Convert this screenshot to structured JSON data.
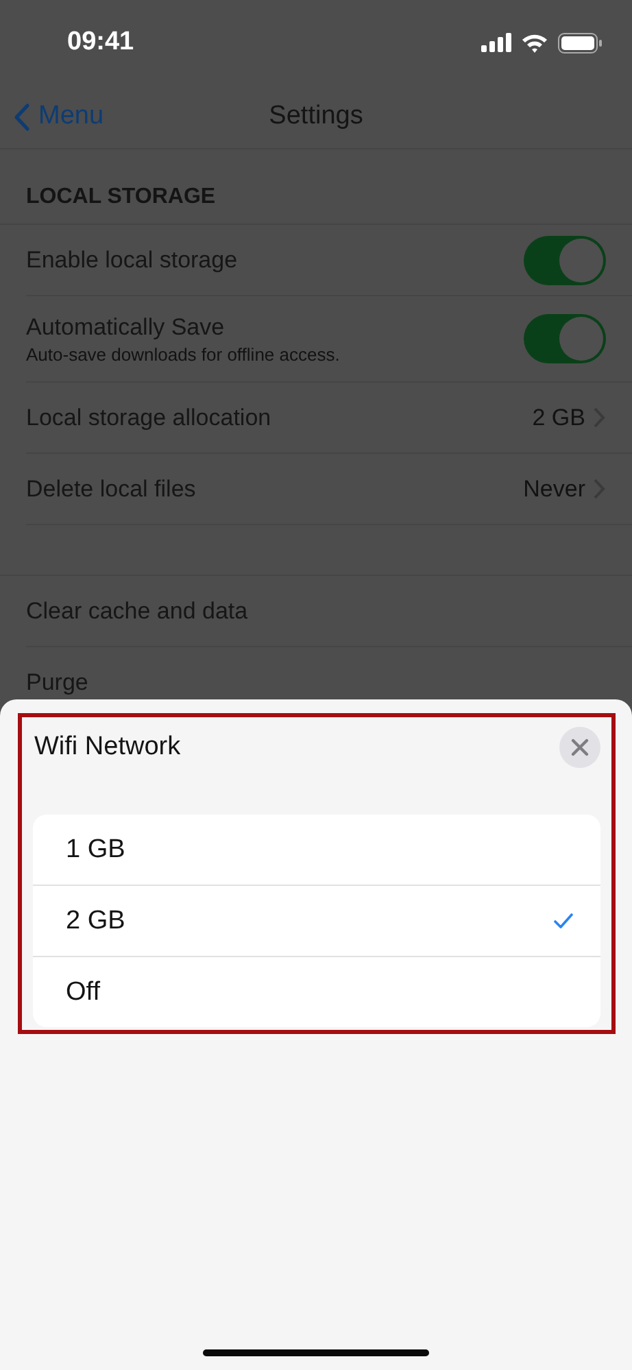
{
  "status_bar": {
    "time": "09:41"
  },
  "nav": {
    "back": "Menu",
    "title": "Settings"
  },
  "sections": [
    {
      "header": "LOCAL STORAGE",
      "rows": [
        {
          "kind": "toggle",
          "label": "Enable local storage",
          "on": true
        },
        {
          "kind": "toggle",
          "label": "Automatically Save",
          "subtitle": "Auto-save downloads for offline access.",
          "on": true
        },
        {
          "kind": "value",
          "label": "Local storage allocation",
          "value": "2 GB"
        },
        {
          "kind": "value",
          "label": "Delete local files",
          "value": "Never"
        }
      ]
    },
    {
      "rows": [
        {
          "kind": "plain",
          "label": "Clear cache and data"
        },
        {
          "kind": "plain",
          "label": "Purge"
        }
      ]
    }
  ],
  "sheet": {
    "title": "Wifi Network",
    "options": [
      {
        "label": "1 GB",
        "selected": false
      },
      {
        "label": "2 GB",
        "selected": true
      },
      {
        "label": "Off",
        "selected": false
      }
    ]
  }
}
